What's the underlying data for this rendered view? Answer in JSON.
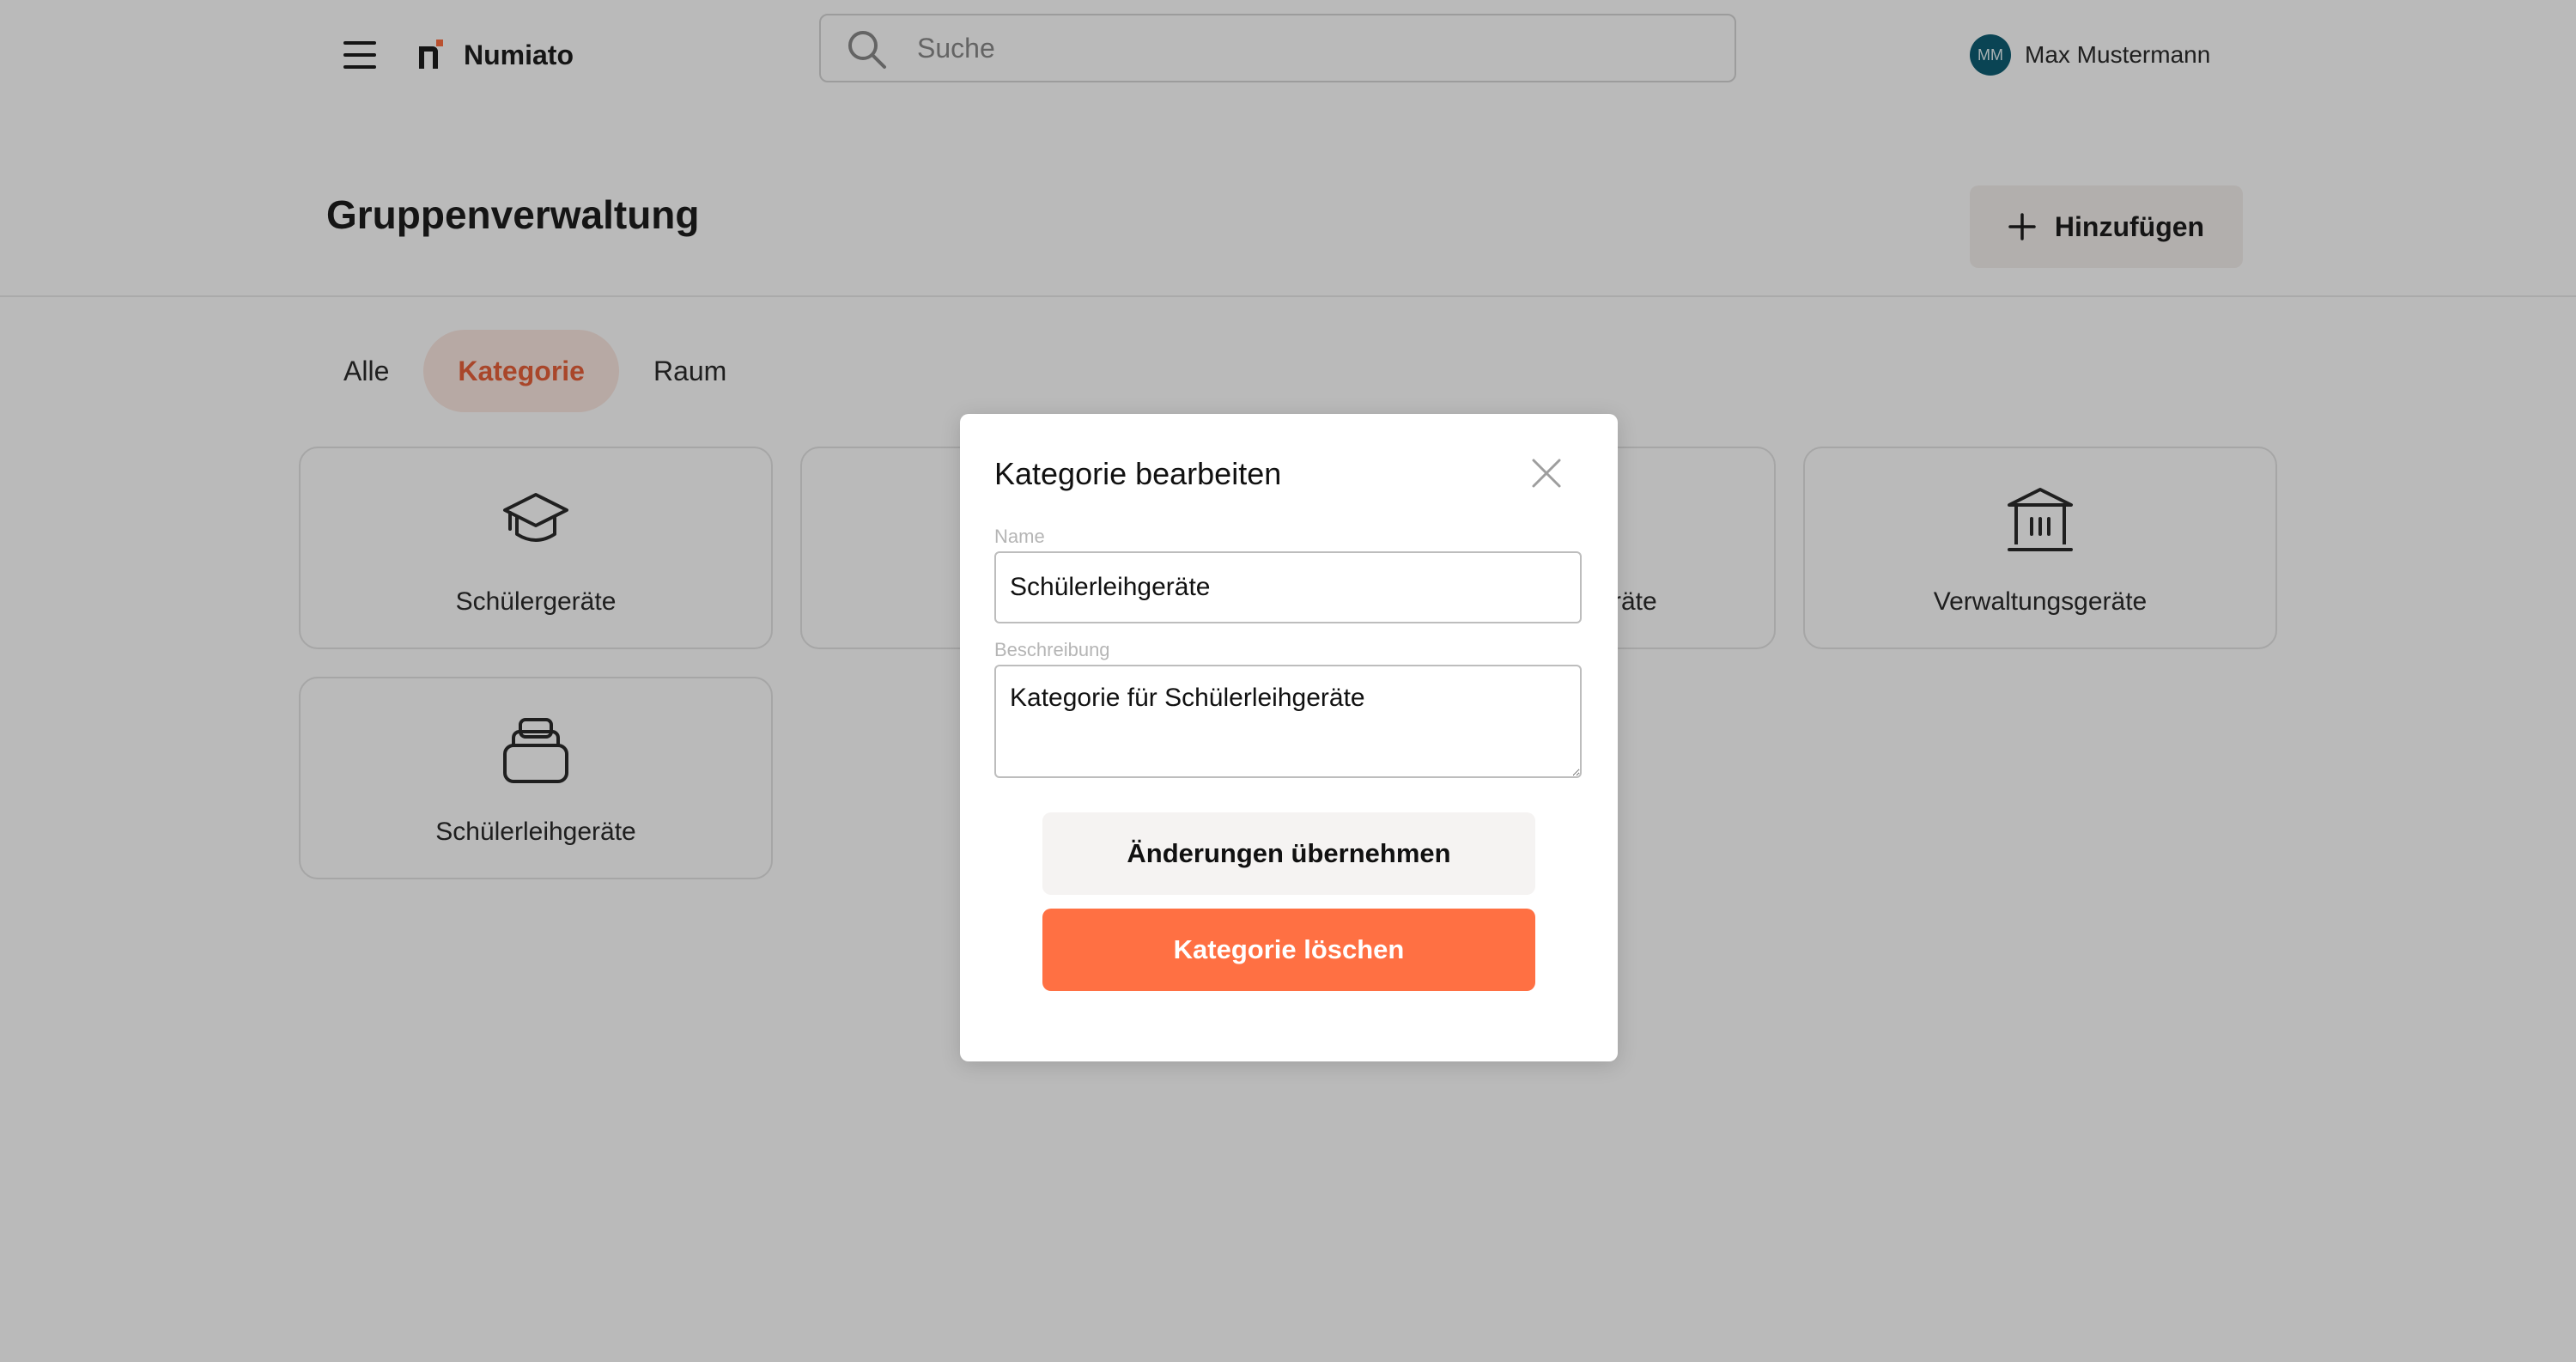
{
  "header": {
    "brand": "Numiato",
    "search": {
      "placeholder": "Suche",
      "value": ""
    },
    "user": {
      "initials": "MM",
      "name": "Max Mustermann"
    }
  },
  "page": {
    "title": "Gruppenverwaltung",
    "add_label": "Hinzufügen"
  },
  "tabs": [
    {
      "label": "Alle",
      "active": false
    },
    {
      "label": "Kategorie",
      "active": true
    },
    {
      "label": "Raum",
      "active": false
    }
  ],
  "cards": [
    {
      "label": "Schülergeräte",
      "icon": "graduation-cap-icon"
    },
    {
      "label": "",
      "icon": ""
    },
    {
      "label": "räte",
      "icon": ""
    },
    {
      "label": "Verwaltungsgeräte",
      "icon": "building-icon"
    },
    {
      "label": "Schülerleihgeräte",
      "icon": "stack-icon"
    }
  ],
  "modal": {
    "title": "Kategorie bearbeiten",
    "name_label": "Name",
    "name_value": "Schülerleihgeräte",
    "description_label": "Beschreibung",
    "description_value": "Kategorie für Schülerleihgeräte",
    "apply_label": "Änderungen übernehmen",
    "delete_label": "Kategorie löschen"
  },
  "colors": {
    "accent": "#ff7043",
    "accent_text": "#e8613a",
    "tab_active_bg": "#fbe8e1",
    "avatar_bg": "#0e5e73",
    "button_secondary_bg": "#f5f3f2"
  }
}
